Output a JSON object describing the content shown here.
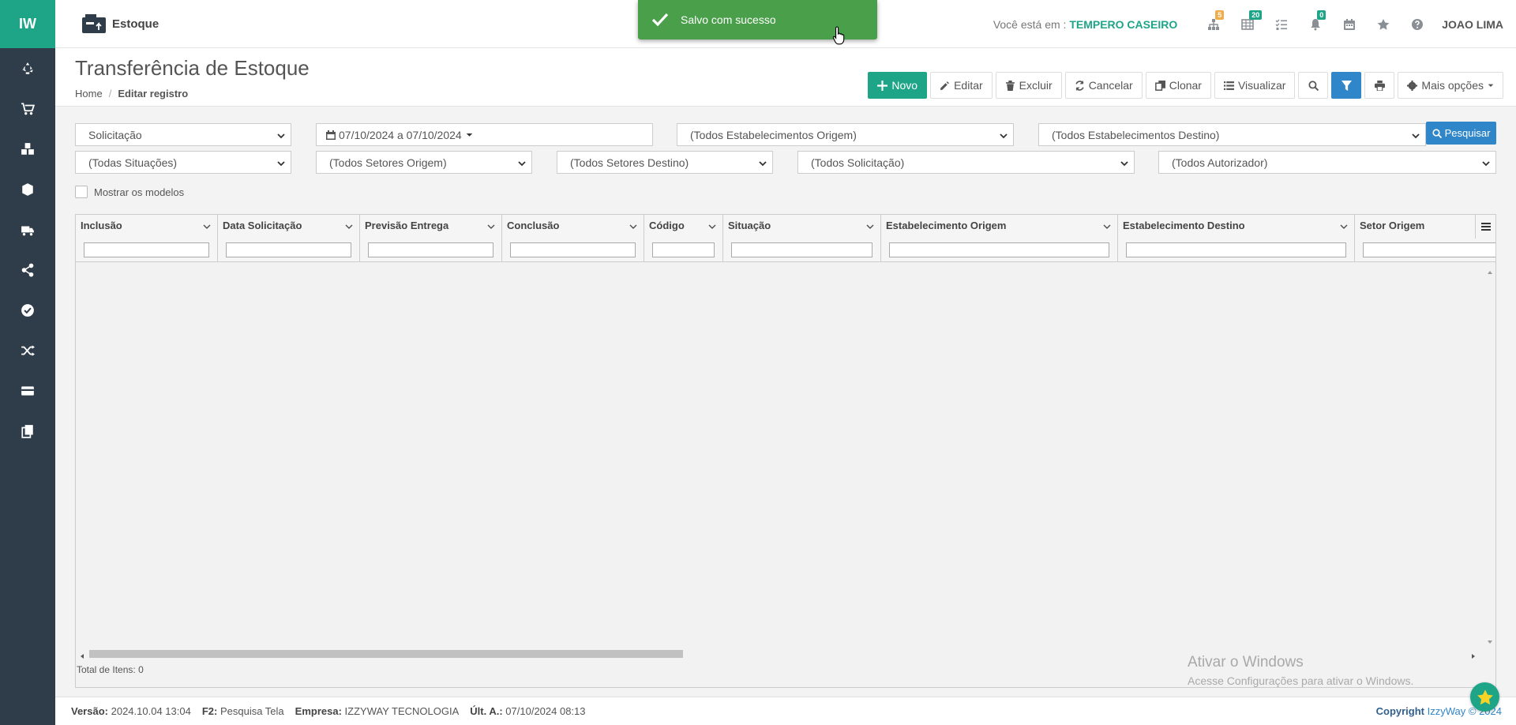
{
  "sidebar": {
    "logo": "IW",
    "items": [
      {
        "icon": "recycle-icon"
      },
      {
        "icon": "cart-icon"
      },
      {
        "icon": "cubes-icon"
      },
      {
        "icon": "cube-icon"
      },
      {
        "icon": "truck-icon"
      },
      {
        "icon": "share-icon"
      },
      {
        "icon": "check-circle-icon"
      },
      {
        "icon": "shuffle-icon"
      },
      {
        "icon": "card-icon"
      },
      {
        "icon": "copy-icon"
      }
    ]
  },
  "topbar": {
    "module": "Estoque",
    "location_prefix": "Você está em :",
    "location": "TEMPERO CASEIRO",
    "badges": {
      "sitemap": "5",
      "table": "20",
      "bell": "0"
    },
    "badge_colors": {
      "sitemap": "#f0ad4e",
      "table": "#1ea588",
      "bell": "#1ea588"
    },
    "user": "JOAO LIMA"
  },
  "toast": {
    "message": "Salvo com sucesso"
  },
  "page": {
    "title": "Transferência de Estoque",
    "breadcrumb": {
      "home": "Home",
      "sep": "/",
      "current": "Editar registro"
    }
  },
  "toolbar": {
    "novo": "Novo",
    "editar": "Editar",
    "excluir": "Excluir",
    "cancelar": "Cancelar",
    "clonar": "Clonar",
    "visualizar": "Visualizar",
    "mais": "Mais opções"
  },
  "filters": {
    "tipo": "Solicitação",
    "periodo": "07/10/2024 a 07/10/2024",
    "estab_origem": "(Todos Estabelecimentos Origem)",
    "estab_destino": "(Todos Estabelecimentos Destino)",
    "pesquisar": "Pesquisar",
    "situacoes": "(Todas Situações)",
    "setores_origem": "(Todos Setores Origem)",
    "setores_destino": "(Todos Setores Destino)",
    "solicitacao": "(Todos Solicitação)",
    "autorizador": "(Todos Autorizador)",
    "mostrar_modelos": "Mostrar os modelos"
  },
  "grid": {
    "columns": [
      "Inclusão",
      "Data Solicitação",
      "Previsão Entrega",
      "Conclusão",
      "Código",
      "Situação",
      "Estabelecimento Origem",
      "Estabelecimento Destino",
      "Setor Origem"
    ],
    "rows": [],
    "total_label": "Total de Itens:",
    "total": "0"
  },
  "watermark": {
    "line1": "Ativar o Windows",
    "line2": "Acesse Configurações para ativar o Windows."
  },
  "footer": {
    "versao_label": "Versão:",
    "versao": "2024.10.04 13:04",
    "f2_label": "F2:",
    "f2": "Pesquisa Tela",
    "empresa_label": "Empresa:",
    "empresa": "IZZYWAY TECNOLOGIA",
    "ult_label": "Últ. A.:",
    "ult": "07/10/2024 08:13",
    "copyright_label": "Copyright",
    "copyright": "IzzyWay © 2024"
  },
  "colors": {
    "brand": "#1ea588",
    "sidebar": "#2f3d4a",
    "primary": "#2f86c9",
    "toast": "#4aa04a"
  }
}
